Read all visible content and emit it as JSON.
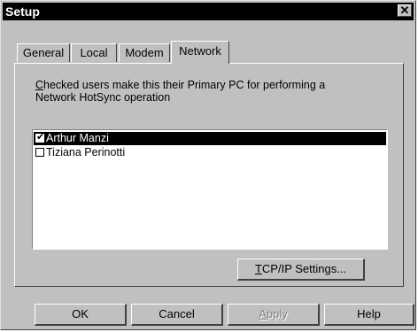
{
  "window": {
    "title": "Setup"
  },
  "tabs": [
    "General",
    "Local",
    "Modem",
    "Network"
  ],
  "active_tab": "Network",
  "network": {
    "description_access_letter": "C",
    "description_line1_rest": "hecked users make this their Primary PC for performing a",
    "description_line2": "Network HotSync operation",
    "users": [
      {
        "name": "Arthur Manzi",
        "checked": true,
        "selected": true
      },
      {
        "name": "Tiziana Perinotti",
        "checked": false,
        "selected": false
      }
    ],
    "tcpip_access_letter": "T",
    "tcpip_rest": "CP/IP Settings..."
  },
  "buttons": {
    "ok": "OK",
    "cancel": "Cancel",
    "apply_access_letter": "A",
    "apply_rest": "pply",
    "help": "Help"
  },
  "icons": {
    "close": "close-icon",
    "checkbox_checked": "checkmark-icon"
  }
}
